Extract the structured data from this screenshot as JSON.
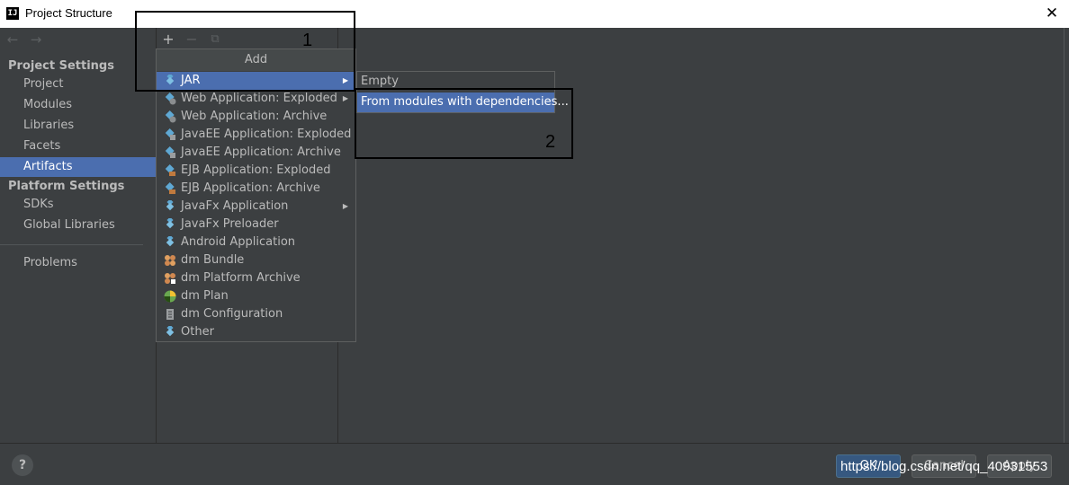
{
  "window": {
    "title": "Project Structure",
    "app_icon_text": "IJ",
    "close_glyph": "✕"
  },
  "nav": {
    "back_glyph": "←",
    "forward_glyph": "→"
  },
  "sidebar": {
    "project_settings_header": "Project Settings",
    "project_settings_items": [
      {
        "label": "Project"
      },
      {
        "label": "Modules"
      },
      {
        "label": "Libraries"
      },
      {
        "label": "Facets"
      },
      {
        "label": "Artifacts",
        "selected": true
      }
    ],
    "platform_settings_header": "Platform Settings",
    "platform_settings_items": [
      {
        "label": "SDKs"
      },
      {
        "label": "Global Libraries"
      }
    ],
    "problems_label": "Problems"
  },
  "toolbar": {
    "add_glyph": "+",
    "remove_glyph": "−",
    "copy_glyph": "⧉"
  },
  "add_menu": {
    "header": "Add",
    "items": [
      {
        "label": "JAR",
        "icon": "artifact-diamond-icon",
        "has_submenu": true,
        "selected": true
      },
      {
        "label": "Web Application: Exploded",
        "icon": "web-artifact-icon",
        "has_submenu": true
      },
      {
        "label": "Web Application: Archive",
        "icon": "web-artifact-icon"
      },
      {
        "label": "JavaEE Application: Exploded",
        "icon": "javaee-artifact-icon"
      },
      {
        "label": "JavaEE Application: Archive",
        "icon": "javaee-artifact-icon"
      },
      {
        "label": "EJB Application: Exploded",
        "icon": "ejb-artifact-icon"
      },
      {
        "label": "EJB Application: Archive",
        "icon": "ejb-artifact-icon"
      },
      {
        "label": "JavaFx Application",
        "icon": "artifact-diamond-icon",
        "has_submenu": true
      },
      {
        "label": "JavaFx Preloader",
        "icon": "artifact-diamond-icon"
      },
      {
        "label": "Android Application",
        "icon": "artifact-diamond-icon"
      },
      {
        "label": "dm Bundle",
        "icon": "dm-bundle-icon"
      },
      {
        "label": "dm Platform Archive",
        "icon": "dm-platform-icon"
      },
      {
        "label": "dm Plan",
        "icon": "dm-plan-icon"
      },
      {
        "label": "dm Configuration",
        "icon": "dm-config-icon"
      },
      {
        "label": "Other",
        "icon": "artifact-diamond-icon"
      }
    ],
    "submenu_arrow_glyph": "▶"
  },
  "jar_submenu": {
    "items": [
      {
        "label": "Empty"
      },
      {
        "label": "From modules with dependencies...",
        "selected": true
      }
    ]
  },
  "annotations": [
    {
      "label": "1"
    },
    {
      "label": "2"
    }
  ],
  "footer": {
    "help_glyph": "?",
    "ok_label": "OK",
    "cancel_label": "Cancel",
    "apply_label": "Apply",
    "watermark": "https://blog.csdn.net/qq_40931553"
  },
  "colors": {
    "background": "#3c3f41",
    "selection": "#4b6eaf",
    "text": "#bbbbbb",
    "artifact_icon": "#5fa8d3"
  }
}
